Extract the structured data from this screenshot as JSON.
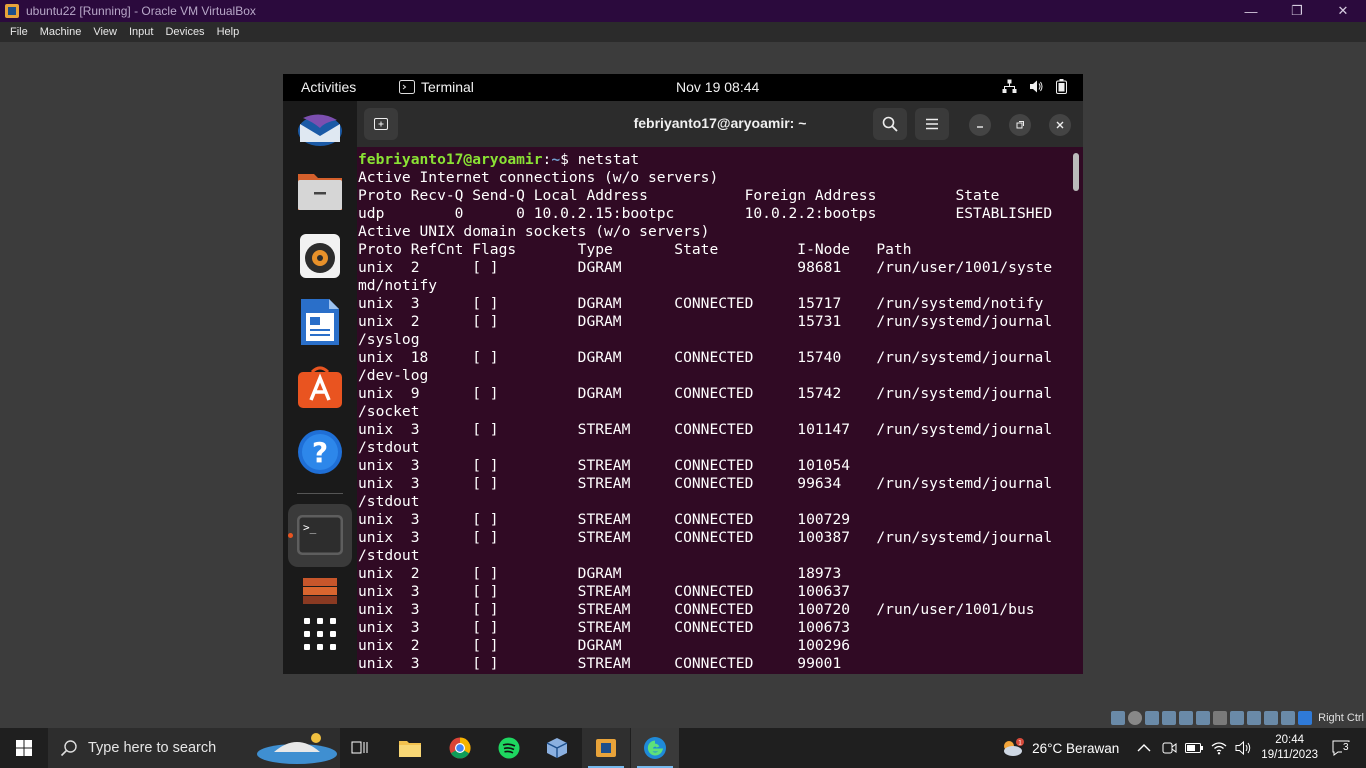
{
  "host_window": {
    "title": "ubuntu22 [Running] - Oracle VM VirtualBox",
    "menu": [
      "File",
      "Machine",
      "View",
      "Input",
      "Devices",
      "Help"
    ],
    "controls": {
      "minimize": "—",
      "restore": "❐",
      "close": "✕"
    }
  },
  "gnome": {
    "activities": "Activities",
    "app_name": "Terminal",
    "clock": "Nov 19  08:44"
  },
  "dock": {
    "items": [
      "thunderbird-icon",
      "files-icon",
      "rhythmbox-icon",
      "libreoffice-writer-icon",
      "app-center-icon",
      "help-icon",
      "terminal-icon",
      "show-apps-icon"
    ],
    "help_glyph": "?",
    "terminal_glyph": ">_"
  },
  "terminal": {
    "title": "febriyanto17@aryoamir: ~",
    "prompt_user": "febriyanto17@aryoamir",
    "prompt_sep": ":",
    "prompt_path": "~",
    "prompt_symbol": "$ ",
    "command": "netstat",
    "output": "Active Internet connections (w/o servers)\nProto Recv-Q Send-Q Local Address           Foreign Address         State\nudp        0      0 10.0.2.15:bootpc        10.0.2.2:bootps         ESTABLISHED\nActive UNIX domain sockets (w/o servers)\nProto RefCnt Flags       Type       State         I-Node   Path\nunix  2      [ ]         DGRAM                    98681    /run/user/1001/syste\nmd/notify\nunix  3      [ ]         DGRAM      CONNECTED     15717    /run/systemd/notify\nunix  2      [ ]         DGRAM                    15731    /run/systemd/journal\n/syslog\nunix  18     [ ]         DGRAM      CONNECTED     15740    /run/systemd/journal\n/dev-log\nunix  9      [ ]         DGRAM      CONNECTED     15742    /run/systemd/journal\n/socket\nunix  3      [ ]         STREAM     CONNECTED     101147   /run/systemd/journal\n/stdout\nunix  3      [ ]         STREAM     CONNECTED     101054   \nunix  3      [ ]         STREAM     CONNECTED     99634    /run/systemd/journal\n/stdout\nunix  3      [ ]         STREAM     CONNECTED     100729   \nunix  3      [ ]         STREAM     CONNECTED     100387   /run/systemd/journal\n/stdout\nunix  2      [ ]         DGRAM                    18973    \nunix  3      [ ]         STREAM     CONNECTED     100637   \nunix  3      [ ]         STREAM     CONNECTED     100720   /run/user/1001/bus\nunix  3      [ ]         STREAM     CONNECTED     100673   \nunix  2      [ ]         DGRAM                    100296   \nunix  3      [ ]         STREAM     CONNECTED     99001    "
  },
  "vbox_status": {
    "host_key": "Right Ctrl"
  },
  "taskbar": {
    "search_placeholder": "Type here to search",
    "weather": "26°C  Berawan",
    "weather_badge": "1",
    "time": "20:44",
    "date": "19/11/2023",
    "notifications": "3"
  },
  "colors": {
    "terminal_bg": "#300a24",
    "prompt_user": "#8ae234",
    "prompt_path": "#729fcf",
    "host_title_bg": "#2b0a3d"
  }
}
